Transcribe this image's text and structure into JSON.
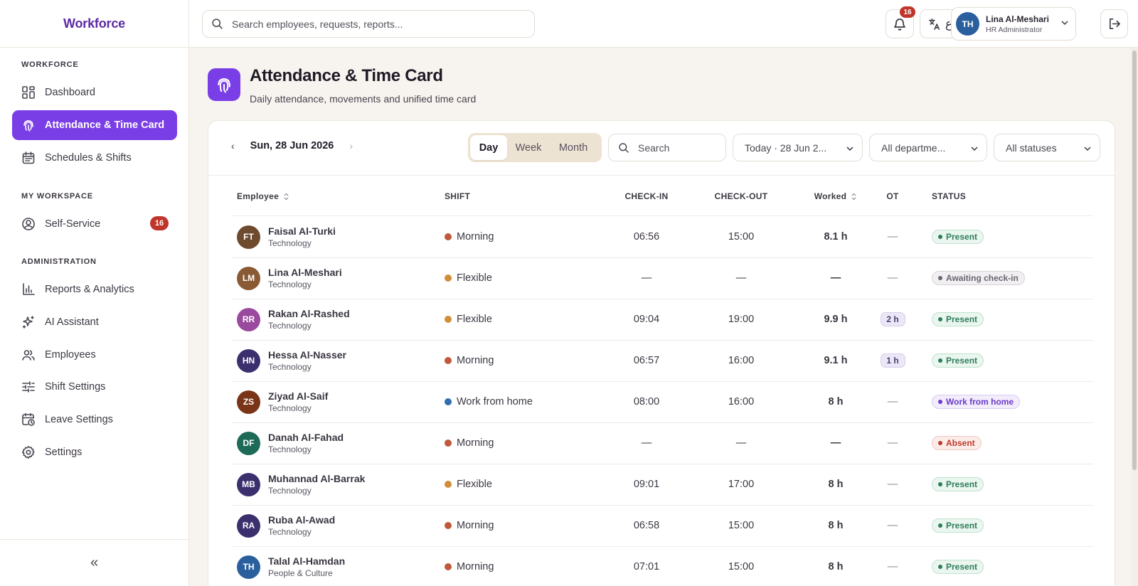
{
  "app": {
    "brand": "Workforce"
  },
  "search": {
    "placeholder": "Search employees, requests, reports..."
  },
  "notifications": {
    "count": "16"
  },
  "language": {
    "label": "ع"
  },
  "user": {
    "initials": "TH",
    "name": "Lina Al-Meshari",
    "role": "HR Administrator"
  },
  "sidebar": {
    "sections": [
      {
        "title": "WORKFORCE"
      },
      {
        "title": "MY WORKSPACE"
      },
      {
        "title": "ADMINISTRATION"
      }
    ],
    "items": [
      {
        "label": "Dashboard",
        "icon": "dashboard-icon"
      },
      {
        "label": "Attendance & Time Card",
        "icon": "fingerprint-icon",
        "active": true
      },
      {
        "label": "Schedules & Shifts",
        "icon": "calendar-icon"
      },
      {
        "label": "Self-Service",
        "icon": "user-circle-icon",
        "badge": "16"
      },
      {
        "label": "Reports & Analytics",
        "icon": "bar-chart-icon"
      },
      {
        "label": "AI Assistant",
        "icon": "sparkle-icon"
      },
      {
        "label": "Employees",
        "icon": "users-icon"
      },
      {
        "label": "Shift Settings",
        "icon": "sliders-icon"
      },
      {
        "label": "Leave Settings",
        "icon": "calendar-clock-icon"
      },
      {
        "label": "Settings",
        "icon": "gear-icon"
      }
    ],
    "collapse_label": "«"
  },
  "page": {
    "title": "Attendance & Time Card",
    "subtitle": "Daily attendance, movements and unified time card"
  },
  "toolbar": {
    "prev": "‹",
    "next": "›",
    "date": "Sun, 28 Jun 2026",
    "views": [
      "Day",
      "Week",
      "Month"
    ],
    "active_view": "Day",
    "search_placeholder": "Search",
    "date_filter": "Today · 28 Jun 2...",
    "department_filter": "All departme...",
    "status_filter": "All statuses"
  },
  "table": {
    "columns": [
      "Employee",
      "SHIFT",
      "CHECK-IN",
      "CHECK-OUT",
      "Worked",
      "OT",
      "STATUS"
    ],
    "rows": [
      {
        "initials": "FT",
        "avatar_color": "#6e4a2e",
        "name": "Faisal Al-Turki",
        "dept": "Technology",
        "shift": "Morning",
        "shift_color": "#c0583a",
        "check_in": "06:56",
        "check_out": "15:00",
        "worked": "8.1 h",
        "ot": "—",
        "status": "Present"
      },
      {
        "initials": "LM",
        "avatar_color": "#8a5a35",
        "name": "Lina Al-Meshari",
        "dept": "Technology",
        "shift": "Flexible",
        "shift_color": "#d08e3a",
        "check_in": "—",
        "check_out": "—",
        "worked": "—",
        "ot": "—",
        "status": "Awaiting check-in"
      },
      {
        "initials": "RR",
        "avatar_color": "#9a4a9e",
        "name": "Rakan Al-Rashed",
        "dept": "Technology",
        "shift": "Flexible",
        "shift_color": "#d08e3a",
        "check_in": "09:04",
        "check_out": "19:00",
        "worked": "9.9 h",
        "ot": "2 h",
        "status": "Present"
      },
      {
        "initials": "HN",
        "avatar_color": "#3b2f6e",
        "name": "Hessa Al-Nasser",
        "dept": "Technology",
        "shift": "Morning",
        "shift_color": "#c0583a",
        "check_in": "06:57",
        "check_out": "16:00",
        "worked": "9.1 h",
        "ot": "1 h",
        "status": "Present"
      },
      {
        "initials": "ZS",
        "avatar_color": "#7a3418",
        "name": "Ziyad Al-Saif",
        "dept": "Technology",
        "shift": "Work from home",
        "shift_color": "#2f6eb4",
        "check_in": "08:00",
        "check_out": "16:00",
        "worked": "8 h",
        "ot": "—",
        "status": "Work from home"
      },
      {
        "initials": "DF",
        "avatar_color": "#1e6a58",
        "name": "Danah Al-Fahad",
        "dept": "Technology",
        "shift": "Morning",
        "shift_color": "#c0583a",
        "check_in": "—",
        "check_out": "—",
        "worked": "—",
        "ot": "—",
        "status": "Absent"
      },
      {
        "initials": "MB",
        "avatar_color": "#3b2f6e",
        "name": "Muhannad Al-Barrak",
        "dept": "Technology",
        "shift": "Flexible",
        "shift_color": "#d08e3a",
        "check_in": "09:01",
        "check_out": "17:00",
        "worked": "8 h",
        "ot": "—",
        "status": "Present"
      },
      {
        "initials": "RA",
        "avatar_color": "#3b2f6e",
        "name": "Ruba Al-Awad",
        "dept": "Technology",
        "shift": "Morning",
        "shift_color": "#c0583a",
        "check_in": "06:58",
        "check_out": "15:00",
        "worked": "8 h",
        "ot": "—",
        "status": "Present"
      },
      {
        "initials": "TH",
        "avatar_color": "#2a5f9e",
        "name": "Talal Al-Hamdan",
        "dept": "People & Culture",
        "shift": "Morning",
        "shift_color": "#c0583a",
        "check_in": "07:01",
        "check_out": "15:00",
        "worked": "8 h",
        "ot": "—",
        "status": "Present"
      }
    ]
  },
  "colors": {
    "accent": "#7a3ee6",
    "badge_red": "#c0352b",
    "present": "#2e7d5b",
    "awaiting": "#6b6670",
    "wfh": "#6a3cc8",
    "absent": "#c0392b"
  }
}
